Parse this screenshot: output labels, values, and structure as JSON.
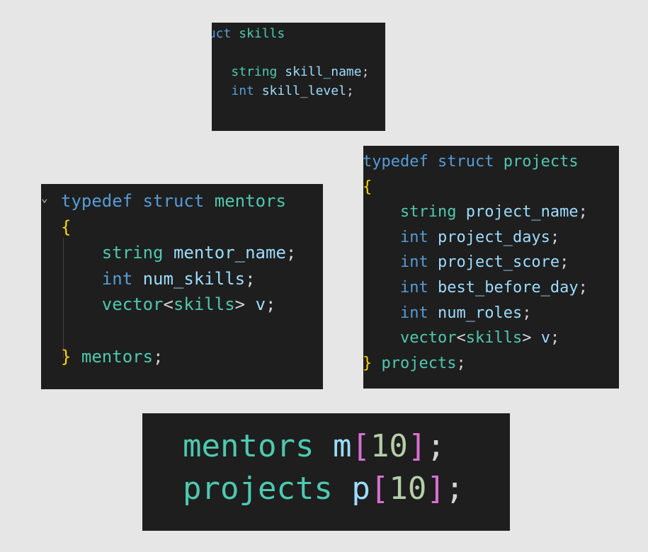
{
  "snippets": {
    "skills": {
      "lines": [
        {
          "tokens": [
            {
              "t": "ruct",
              "c": "kw"
            },
            {
              "t": " ",
              "c": "plain"
            },
            {
              "t": "skills",
              "c": "type"
            }
          ]
        },
        {
          "tokens": []
        },
        {
          "tokens": [
            {
              "t": "    ",
              "c": "plain"
            },
            {
              "t": "string",
              "c": "type"
            },
            {
              "t": " ",
              "c": "plain"
            },
            {
              "t": "skill_name",
              "c": "ident"
            },
            {
              "t": ";",
              "c": "plain"
            }
          ]
        },
        {
          "tokens": [
            {
              "t": "    ",
              "c": "plain"
            },
            {
              "t": "int",
              "c": "kw"
            },
            {
              "t": " ",
              "c": "plain"
            },
            {
              "t": "skill_level",
              "c": "ident"
            },
            {
              "t": ";",
              "c": "plain"
            }
          ]
        }
      ]
    },
    "mentors": {
      "lines": [
        {
          "tokens": [
            {
              "t": "typedef",
              "c": "kw"
            },
            {
              "t": " ",
              "c": "plain"
            },
            {
              "t": "struct",
              "c": "kw"
            },
            {
              "t": " ",
              "c": "plain"
            },
            {
              "t": "mentors",
              "c": "type"
            }
          ]
        },
        {
          "tokens": [
            {
              "t": "{",
              "c": "brace"
            }
          ]
        },
        {
          "tokens": [
            {
              "t": "    ",
              "c": "plain"
            },
            {
              "t": "string",
              "c": "type"
            },
            {
              "t": " ",
              "c": "plain"
            },
            {
              "t": "mentor_name",
              "c": "ident"
            },
            {
              "t": ";",
              "c": "plain"
            }
          ]
        },
        {
          "tokens": [
            {
              "t": "    ",
              "c": "plain"
            },
            {
              "t": "int",
              "c": "kw"
            },
            {
              "t": " ",
              "c": "plain"
            },
            {
              "t": "num_skills",
              "c": "ident"
            },
            {
              "t": ";",
              "c": "plain"
            }
          ]
        },
        {
          "tokens": [
            {
              "t": "    ",
              "c": "plain"
            },
            {
              "t": "vector",
              "c": "type"
            },
            {
              "t": "<",
              "c": "plain"
            },
            {
              "t": "skills",
              "c": "type"
            },
            {
              "t": ">",
              "c": "plain"
            },
            {
              "t": " ",
              "c": "plain"
            },
            {
              "t": "v",
              "c": "ident"
            },
            {
              "t": ";",
              "c": "plain"
            }
          ]
        },
        {
          "tokens": []
        },
        {
          "tokens": [
            {
              "t": "}",
              "c": "brace"
            },
            {
              "t": " ",
              "c": "plain"
            },
            {
              "t": "mentors",
              "c": "type"
            },
            {
              "t": ";",
              "c": "plain"
            }
          ]
        }
      ]
    },
    "projects": {
      "lines": [
        {
          "tokens": [
            {
              "t": "typedef",
              "c": "kw"
            },
            {
              "t": " ",
              "c": "plain"
            },
            {
              "t": "struct",
              "c": "kw"
            },
            {
              "t": " ",
              "c": "plain"
            },
            {
              "t": "projects",
              "c": "type"
            }
          ]
        },
        {
          "tokens": [
            {
              "t": "{",
              "c": "brace"
            }
          ]
        },
        {
          "tokens": [
            {
              "t": "    ",
              "c": "plain"
            },
            {
              "t": "string",
              "c": "type"
            },
            {
              "t": " ",
              "c": "plain"
            },
            {
              "t": "project_name",
              "c": "ident"
            },
            {
              "t": ";",
              "c": "plain"
            }
          ]
        },
        {
          "tokens": [
            {
              "t": "    ",
              "c": "plain"
            },
            {
              "t": "int",
              "c": "kw"
            },
            {
              "t": " ",
              "c": "plain"
            },
            {
              "t": "project_days",
              "c": "ident"
            },
            {
              "t": ";",
              "c": "plain"
            }
          ]
        },
        {
          "tokens": [
            {
              "t": "    ",
              "c": "plain"
            },
            {
              "t": "int",
              "c": "kw"
            },
            {
              "t": " ",
              "c": "plain"
            },
            {
              "t": "project_score",
              "c": "ident"
            },
            {
              "t": ";",
              "c": "plain"
            }
          ]
        },
        {
          "tokens": [
            {
              "t": "    ",
              "c": "plain"
            },
            {
              "t": "int",
              "c": "kw"
            },
            {
              "t": " ",
              "c": "plain"
            },
            {
              "t": "best_before_day",
              "c": "ident"
            },
            {
              "t": ";",
              "c": "plain"
            }
          ]
        },
        {
          "tokens": [
            {
              "t": "    ",
              "c": "plain"
            },
            {
              "t": "int",
              "c": "kw"
            },
            {
              "t": " ",
              "c": "plain"
            },
            {
              "t": "num_roles",
              "c": "ident"
            },
            {
              "t": ";",
              "c": "plain"
            }
          ]
        },
        {
          "tokens": [
            {
              "t": "    ",
              "c": "plain"
            },
            {
              "t": "vector",
              "c": "type"
            },
            {
              "t": "<",
              "c": "plain"
            },
            {
              "t": "skills",
              "c": "type"
            },
            {
              "t": ">",
              "c": "plain"
            },
            {
              "t": " ",
              "c": "plain"
            },
            {
              "t": "v",
              "c": "ident"
            },
            {
              "t": ";",
              "c": "plain"
            }
          ]
        },
        {
          "tokens": [
            {
              "t": "}",
              "c": "brace"
            },
            {
              "t": " ",
              "c": "plain"
            },
            {
              "t": "projects",
              "c": "type"
            },
            {
              "t": ";",
              "c": "plain"
            }
          ]
        }
      ]
    },
    "declarations": {
      "lines": [
        {
          "tokens": [
            {
              "t": "mentors",
              "c": "type"
            },
            {
              "t": " ",
              "c": "plain"
            },
            {
              "t": "m",
              "c": "ident"
            },
            {
              "t": "[",
              "c": "bracket"
            },
            {
              "t": "10",
              "c": "num"
            },
            {
              "t": "]",
              "c": "bracket"
            },
            {
              "t": ";",
              "c": "plain"
            }
          ]
        },
        {
          "tokens": [
            {
              "t": "projects",
              "c": "type"
            },
            {
              "t": " ",
              "c": "plain"
            },
            {
              "t": "p",
              "c": "ident"
            },
            {
              "t": "[",
              "c": "bracket"
            },
            {
              "t": "10",
              "c": "num"
            },
            {
              "t": "]",
              "c": "bracket"
            },
            {
              "t": ";",
              "c": "plain"
            }
          ]
        }
      ]
    }
  },
  "icons": {
    "fold_chevron": "chevron-down-icon"
  },
  "colors": {
    "background": "#e6e6e6",
    "editor_bg": "#1e1e1e",
    "keyword": "#569cd6",
    "type": "#4ec9b0",
    "identifier": "#9cdcfe",
    "punctuation": "#d4d4d4",
    "brace": "#ffd700",
    "number": "#b5cea8",
    "bracket": "#da70d6"
  }
}
